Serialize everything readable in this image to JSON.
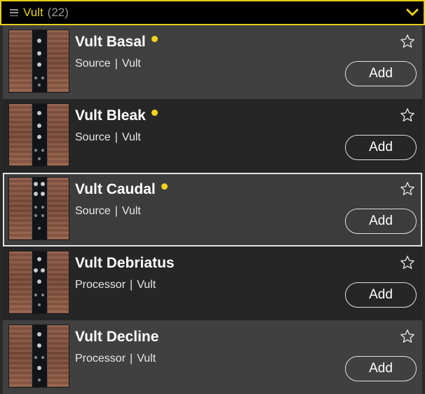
{
  "header": {
    "title": "Vult",
    "count": "(22)",
    "accent": "#e6cf1a"
  },
  "items": [
    {
      "name": "Vult Basal",
      "category": "Source",
      "separator": "|",
      "brand": "Vult",
      "new": true,
      "add_label": "Add"
    },
    {
      "name": "Vult Bleak",
      "category": "Source",
      "separator": "|",
      "brand": "Vult",
      "new": true,
      "add_label": "Add"
    },
    {
      "name": "Vult Caudal",
      "category": "Source",
      "separator": "|",
      "brand": "Vult",
      "new": true,
      "add_label": "Add",
      "selected": true
    },
    {
      "name": "Vult Debriatus",
      "category": "Processor",
      "separator": "|",
      "brand": "Vult",
      "new": false,
      "add_label": "Add"
    },
    {
      "name": "Vult Decline",
      "category": "Processor",
      "separator": "|",
      "brand": "Vult",
      "new": false,
      "add_label": "Add"
    }
  ],
  "icons": {
    "menu": "list-icon",
    "chevron": "chevron-down-icon",
    "favorite": "star-outline-icon",
    "new_badge": "dot-icon"
  }
}
